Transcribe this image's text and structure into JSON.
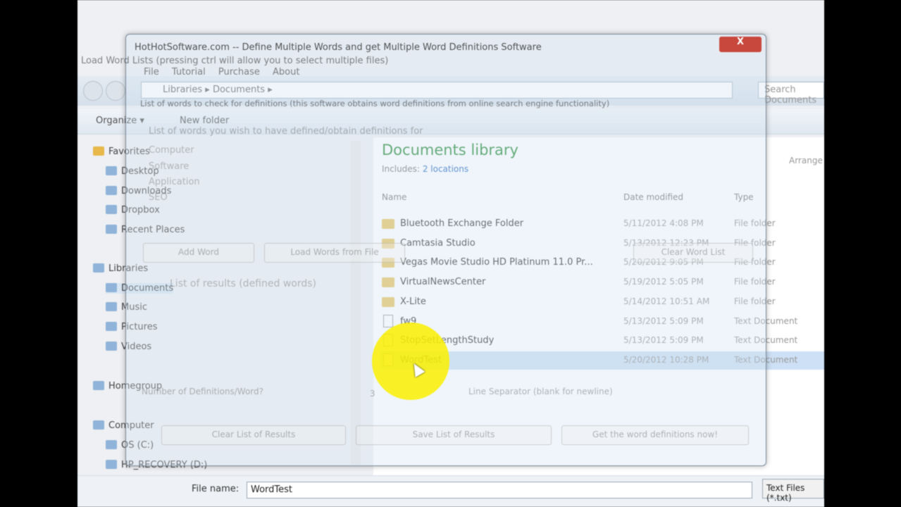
{
  "explorer": {
    "address": [
      "Libraries",
      "Documents"
    ],
    "search_placeholder": "Search Documents",
    "toolbar": {
      "organize": "Organize ▾",
      "new_folder": "New folder"
    },
    "sidebar": [
      {
        "label": "Favorites"
      },
      {
        "label": "Desktop"
      },
      {
        "label": "Downloads"
      },
      {
        "label": "Dropbox"
      },
      {
        "label": "Recent Places"
      },
      {
        "label": "Libraries"
      },
      {
        "label": "Documents"
      },
      {
        "label": "Music"
      },
      {
        "label": "Pictures"
      },
      {
        "label": "Videos"
      },
      {
        "label": "Homegroup"
      },
      {
        "label": "Computer"
      },
      {
        "label": "OS (C:)"
      },
      {
        "label": "HP_RECOVERY (D:)"
      }
    ],
    "library_title": "Documents library",
    "includes_label": "Includes:",
    "includes_link": "2 locations",
    "arrange": "Arrange",
    "columns": {
      "name": "Name",
      "date": "Date modified",
      "type": "Type"
    },
    "files": [
      {
        "name": "Bluetooth Exchange Folder",
        "date": "5/11/2012 4:08 PM",
        "type": "File folder",
        "kind": "folder"
      },
      {
        "name": "Camtasia Studio",
        "date": "5/13/2012 12:23 PM",
        "type": "File folder",
        "kind": "folder"
      },
      {
        "name": "Vegas Movie Studio HD Platinum 11.0 Pr...",
        "date": "5/20/2012 9:05 PM",
        "type": "File folder",
        "kind": "folder"
      },
      {
        "name": "VirtualNewsCenter",
        "date": "5/19/2012 5:05 PM",
        "type": "File folder",
        "kind": "folder"
      },
      {
        "name": "X-Lite",
        "date": "5/14/2012 10:51 AM",
        "type": "File folder",
        "kind": "folder"
      },
      {
        "name": "fw9",
        "date": "5/13/2012 5:09 PM",
        "type": "Text Document",
        "kind": "doc"
      },
      {
        "name": "StopSetLengthStudy",
        "date": "5/13/2012 5:09 PM",
        "type": "Text Document",
        "kind": "doc"
      },
      {
        "name": "WordTest",
        "date": "5/20/2012 10:28 PM",
        "type": "Text Document",
        "kind": "doc"
      }
    ],
    "file_name_label": "File name:",
    "file_name_value": "WordTest",
    "file_type": "Text Files (*.txt)"
  },
  "app": {
    "title": "HotHotSoftware.com -- Define Multiple Words and get Multiple Word Definitions Software",
    "dialog_title": "Load Word Lists (pressing ctrl will allow you to select multiple files)",
    "menu": [
      "File",
      "Tutorial",
      "Purchase",
      "About"
    ],
    "close": "X",
    "words_header": "List of words to check for definitions (this software obtains word definitions from online search engine functionality)",
    "words_label": "List of words you wish to have defined/obtain definitions for",
    "words": [
      "Computer",
      "Software",
      "Application",
      "SEO"
    ],
    "buttons": {
      "add": "Add Word",
      "load": "Load Words from File",
      "clear": "Clear Word List",
      "clear_results": "Clear List of Results",
      "save_results": "Save List of Results",
      "get": "Get the word definitions now!"
    },
    "results_label": "List of results (defined words)",
    "defs_label": "Number of Definitions/Word?",
    "defs_value": "3",
    "separator_label": "Line Separator (blank for newline)"
  }
}
